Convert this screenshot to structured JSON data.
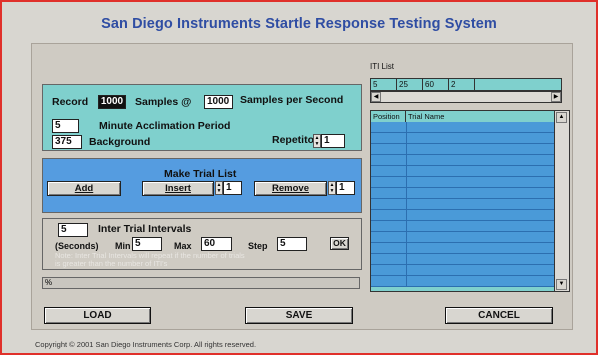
{
  "title": "San Diego Instruments  Startle Response Testing System",
  "record": {
    "record_label": "Record",
    "record_value": "1000",
    "samples_at_label": "Samples @",
    "samples_at_value": "1000",
    "samples_per_second_label": "Samples per Second",
    "acclimation_value": "5",
    "acclimation_label": "Minute Acclimation Period",
    "background_value": "375",
    "background_label": "Background",
    "repetitions_label": "Repetitons",
    "repetitions_value": "1"
  },
  "trial_list": {
    "title": "Make Trial List",
    "add_label": "Add",
    "insert_label": "Insert",
    "insert_value": "1",
    "remove_label": "Remove",
    "remove_value": "1"
  },
  "iti": {
    "count_value": "5",
    "title": "Inter Trial Intervals",
    "seconds_label": "(Seconds)",
    "min_label": "Min",
    "min_value": "5",
    "max_label": "Max",
    "max_value": "60",
    "step_label": "Step",
    "step_value": "5",
    "ok_label": "OK",
    "note_line1": "Note: Inter Trial Intervals will repeat if the number of trials",
    "note_line2": "is greater than  the number of ITI's"
  },
  "progress_label": "%",
  "iti_list": {
    "label": "ITI List",
    "values": [
      "5",
      "25",
      "60",
      "2"
    ]
  },
  "trial_table": {
    "headers": [
      "Position",
      "Trial Name"
    ],
    "row_count": 15
  },
  "buttons": {
    "load": "LOAD",
    "save": "SAVE",
    "cancel": "CANCEL"
  },
  "copyright": "Copyright © 2001 San Diego Instruments Corp. All rights reserved.",
  "colors": {
    "accent_teal": "#7fd0cd",
    "accent_blue": "#559ce0",
    "title_blue": "#2f4da3",
    "frame_red": "#e0302a"
  }
}
